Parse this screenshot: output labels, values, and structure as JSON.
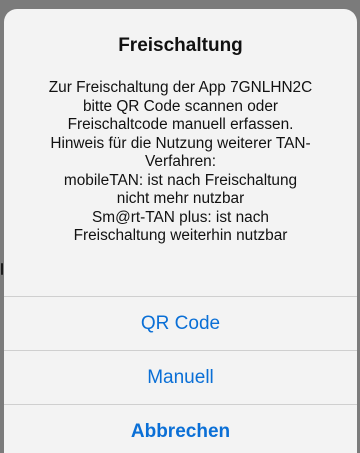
{
  "alert": {
    "title": "Freischaltung",
    "message_lines": [
      "Zur Freischaltung der App 7GNLHN2C",
      "bitte QR Code scannen oder",
      "Freischaltcode manuell erfassen.",
      "Hinweis für die Nutzung weiterer TAN-",
      "Verfahren:",
      "mobileTAN: ist nach Freischaltung",
      "nicht mehr nutzbar",
      "Sm@rt-TAN plus: ist nach",
      "Freischaltung weiterhin nutzbar"
    ],
    "actions": {
      "qr_code": "QR Code",
      "manual": "Manuell",
      "cancel": "Abbrechen"
    }
  },
  "colors": {
    "action_text": "#0a6fd6",
    "sheet_background": "#f3f3f3",
    "dim_overlay": "#7b7b7b"
  }
}
